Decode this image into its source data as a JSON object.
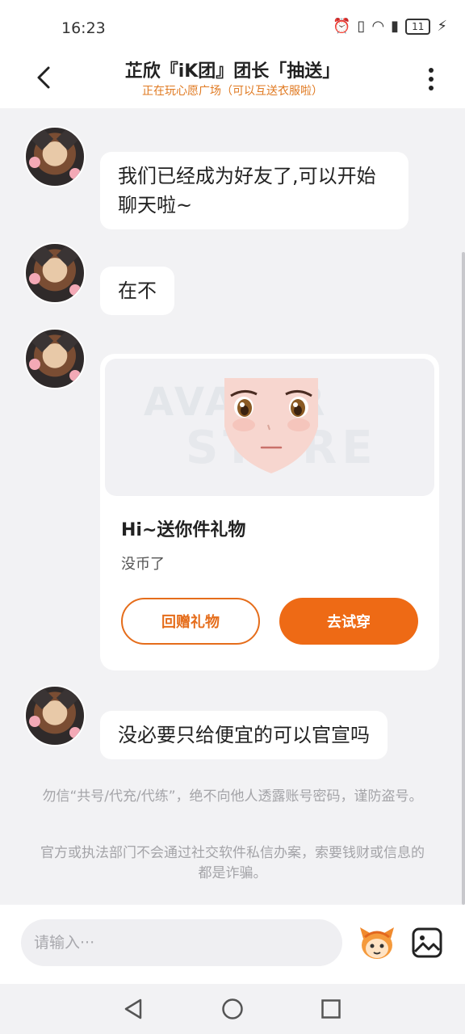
{
  "status_bar": {
    "time": "16:23",
    "battery": "11"
  },
  "header": {
    "title": "芷欣『iK团』团长「抽送」",
    "subtitle": "正在玩心愿广场（可以互送衣服啦）"
  },
  "messages": [
    {
      "text": "我们已经成为好友了,可以开始聊天啦~"
    },
    {
      "text": "在不"
    },
    {
      "text": "没必要只给便宜的可以官宣吗"
    }
  ],
  "gift_card": {
    "watermark_top": "AVATAR",
    "watermark_bottom": "STORE",
    "title": "Hi~送你件礼物",
    "description": "没币了",
    "return_gift_label": "回赠礼物",
    "try_on_label": "去试穿"
  },
  "notices": {
    "line1": "勿信“共号/代充/代练”，绝不向他人透露账号密码，谨防盗号。",
    "line2": "官方或执法部门不会通过社交软件私信办案，索要钱财或信息的都是诈骗。"
  },
  "input": {
    "placeholder": "请输入···"
  },
  "colors": {
    "accent": "#ee6a15",
    "subtitle": "#e07a22",
    "background": "#f2f2f4"
  },
  "icons": [
    "back-icon",
    "more-icon",
    "emoji-icon",
    "image-icon",
    "nav-back-icon",
    "nav-home-icon",
    "nav-recent-icon"
  ]
}
